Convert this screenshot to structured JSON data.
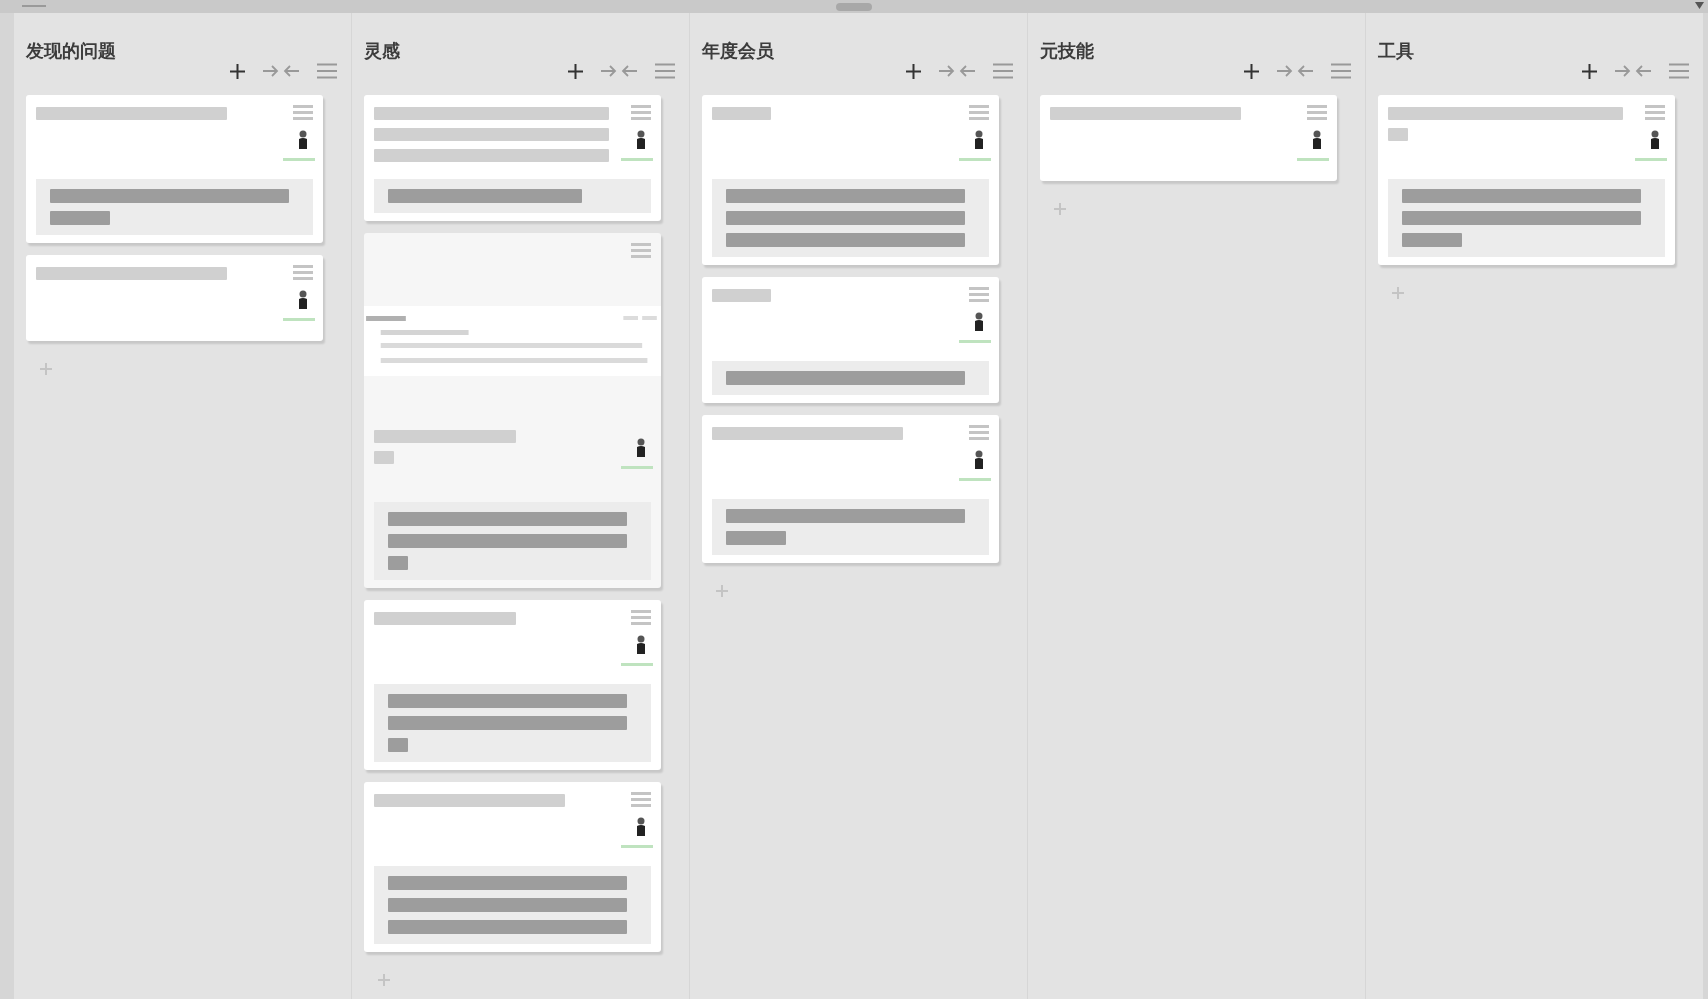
{
  "top_bar": {
    "title": {
      "kind": "redacted_short"
    }
  },
  "columns": [
    {
      "title": "发现的问题",
      "cards": [
        {
          "kind": "text",
          "title_lines": [
            {
              "kind": "long"
            }
          ],
          "note_lines": [
            {
              "kind": "full"
            },
            {
              "kind": "short"
            }
          ]
        },
        {
          "kind": "text",
          "title_lines": [
            {
              "kind": "long"
            }
          ]
        }
      ]
    },
    {
      "title": "灵感",
      "cards": [
        {
          "kind": "text",
          "title_lines": [
            {
              "kind": "full"
            },
            {
              "kind": "full"
            },
            {
              "kind": "full"
            }
          ],
          "note_lines": [
            {
              "kind": "long"
            }
          ]
        },
        {
          "title_lines": [
            {
              "kind": "medium"
            },
            {
              "kind": "tiny"
            }
          ],
          "note_lines": [
            {
              "kind": "full"
            },
            {
              "kind": "full"
            },
            {
              "kind": "tiny"
            }
          ]
        },
        {
          "kind": "text",
          "title_lines": [
            {
              "kind": "medium"
            }
          ],
          "note_lines": [
            {
              "kind": "full"
            },
            {
              "kind": "full"
            },
            {
              "kind": "tiny"
            }
          ]
        },
        {
          "kind": "text",
          "title_lines": [
            {
              "kind": "long"
            }
          ],
          "note_lines": [
            {
              "kind": "full"
            },
            {
              "kind": "full"
            },
            {
              "kind": "full"
            }
          ]
        }
      ]
    },
    {
      "title": "年度会员",
      "cards": [
        {
          "kind": "text",
          "title_lines": [
            {
              "kind": "short"
            }
          ],
          "note_lines": [
            {
              "kind": "full"
            },
            {
              "kind": "full"
            },
            {
              "kind": "full"
            }
          ]
        },
        {
          "kind": "text",
          "title_lines": [
            {
              "kind": "short"
            }
          ],
          "note_lines": [
            {
              "kind": "full"
            }
          ]
        },
        {
          "kind": "text",
          "title_lines": [
            {
              "kind": "long"
            }
          ],
          "note_lines": [
            {
              "kind": "full"
            },
            {
              "kind": "short"
            }
          ]
        }
      ]
    },
    {
      "title": "元技能",
      "cards": [
        {
          "kind": "text",
          "title_lines": [
            {
              "kind": "long"
            }
          ]
        }
      ]
    },
    {
      "title": "工具",
      "cards": [
        {
          "kind": "text",
          "title_lines": [
            {
              "kind": "full"
            },
            {
              "kind": "tiny"
            }
          ],
          "note_lines": [
            {
              "kind": "full"
            },
            {
              "kind": "full"
            },
            {
              "kind": "short"
            }
          ]
        }
      ]
    }
  ]
}
